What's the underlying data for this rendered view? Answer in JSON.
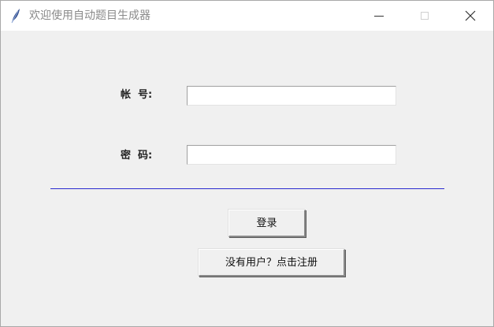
{
  "window": {
    "title": "欢迎使用自动题目生成器",
    "icon": "feather-icon"
  },
  "form": {
    "account_label": "帐  号:",
    "account_value": "",
    "password_label": "密  码:",
    "password_value": ""
  },
  "buttons": {
    "login_label": "登录",
    "register_label": "没有用户？点击注册"
  },
  "colors": {
    "separator": "#2a2ad0",
    "background": "#f0f0f0"
  }
}
